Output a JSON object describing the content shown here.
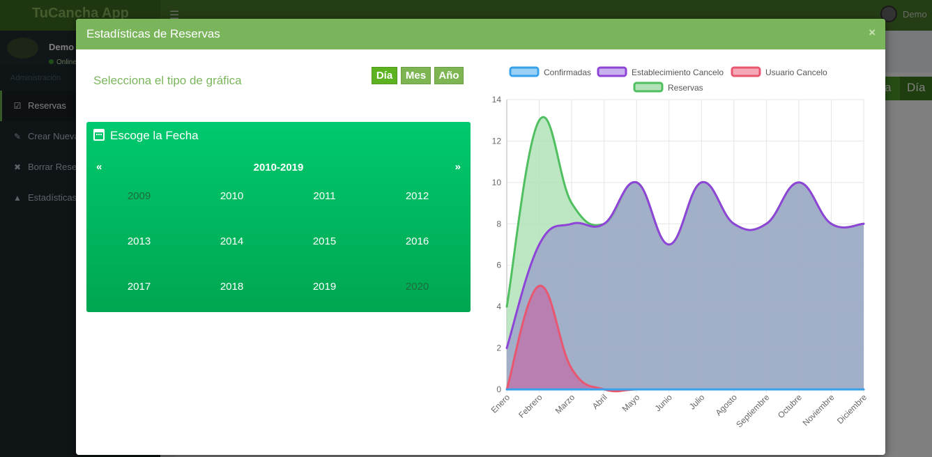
{
  "app": {
    "logo": "TuCancha App",
    "user_name": "Demo",
    "user_status": "Online",
    "sidebar_header": "Administración",
    "sidebar_items": [
      {
        "label": "Reservas",
        "icon": "calendar-check-icon"
      },
      {
        "label": "Crear Nueva",
        "icon": "edit-icon"
      },
      {
        "label": "Borrar Rese",
        "icon": "times-icon"
      },
      {
        "label": "Estadísticas",
        "icon": "area-chart-icon"
      }
    ],
    "content_dia_button": "Día",
    "content_partial_button": "a"
  },
  "modal": {
    "title": "Estadísticas de Reservas",
    "close": "×",
    "select_label": "Selecciona el tipo de gráfica",
    "chart_type_buttons": [
      "Día",
      "Mes",
      "Año"
    ],
    "active_type": "Día"
  },
  "calendar": {
    "heading": "Escoge la Fecha",
    "prev": "«",
    "next": "»",
    "decade": "2010-2019",
    "years": [
      {
        "label": "2009",
        "muted": true
      },
      {
        "label": "2010",
        "muted": false
      },
      {
        "label": "2011",
        "muted": false
      },
      {
        "label": "2012",
        "muted": false
      },
      {
        "label": "2013",
        "muted": false
      },
      {
        "label": "2014",
        "muted": false
      },
      {
        "label": "2015",
        "muted": false
      },
      {
        "label": "2016",
        "muted": false
      },
      {
        "label": "2017",
        "muted": false
      },
      {
        "label": "2018",
        "muted": false
      },
      {
        "label": "2019",
        "muted": false
      },
      {
        "label": "2020",
        "muted": true
      }
    ]
  },
  "chart_data": {
    "type": "area",
    "title": "",
    "xlabel": "",
    "ylabel": "",
    "categories": [
      "Enero",
      "Febrero",
      "Marzo",
      "Abril",
      "Mayo",
      "Junio",
      "Julio",
      "Agosto",
      "Septiembre",
      "Octubre",
      "Noviembre",
      "Diciembre"
    ],
    "ylim": [
      0,
      14
    ],
    "yticks": [
      0,
      2,
      4,
      6,
      8,
      10,
      12,
      14
    ],
    "grid": true,
    "legend_position": "top",
    "series": [
      {
        "name": "Confirmadas",
        "values": [
          0,
          0,
          0,
          0,
          0,
          0,
          0,
          0,
          0,
          0,
          0,
          0
        ],
        "stroke": "#36a2eb",
        "fill": "#9ad0f5"
      },
      {
        "name": "Establecimiento Cancelo",
        "values": [
          2,
          7,
          8,
          8,
          10,
          7,
          10,
          8,
          8,
          10,
          8,
          8
        ],
        "stroke": "#8e44d6",
        "fill": "#c9b1ee"
      },
      {
        "name": "Usuario Cancelo",
        "values": [
          0,
          5,
          1,
          0,
          0,
          0,
          0,
          0,
          0,
          0,
          0,
          0
        ],
        "stroke": "#e8566f",
        "fill": "#f5a9b6"
      },
      {
        "name": "Reservas",
        "values": [
          4,
          13,
          9,
          8,
          10,
          7,
          10,
          8,
          8,
          10,
          8,
          8
        ],
        "stroke": "#4fbf5f",
        "fill": "#b2e2b8"
      }
    ]
  }
}
